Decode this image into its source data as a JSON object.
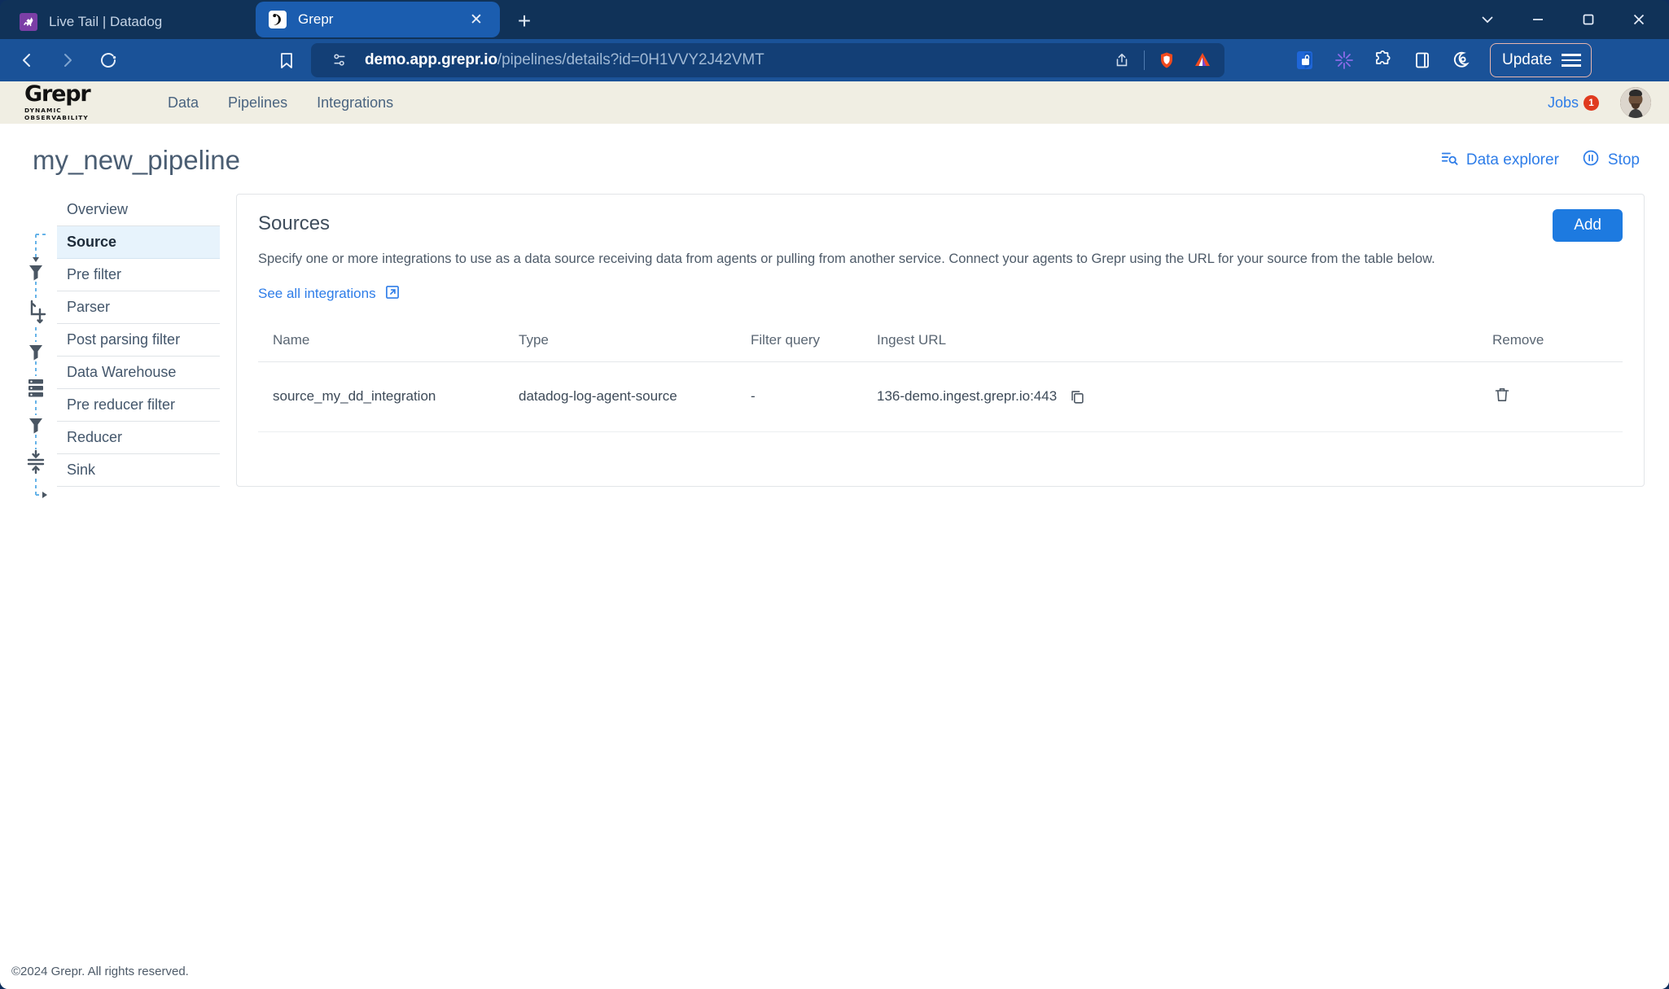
{
  "browser": {
    "tabs": [
      {
        "title": "Live Tail | Datadog",
        "favicon": "datadog-favicon",
        "active": false
      },
      {
        "title": "Grepr",
        "favicon": "grepr-favicon",
        "active": true
      }
    ],
    "close_label": "✕",
    "newtab_label": "+",
    "window_controls": {
      "expand": "⌄",
      "minimize": "─",
      "maximize": "□",
      "close": "✕"
    },
    "nav": {
      "back": "back-icon",
      "forward": "forward-icon",
      "reload": "reload-icon",
      "bookmark": "bookmark-icon"
    },
    "url": {
      "host": "demo.app.grepr.io",
      "path": "/pipelines/details?id=0H1VVY2J42VMT"
    },
    "url_actions": [
      "share-icon",
      "brave-shields-icon",
      "brave-rewards-icon"
    ],
    "extensions": [
      "bitwarden-icon",
      "extension-sparkle-icon",
      "puzzle-extensions-icon",
      "sidebar-panel-icon",
      "brave-leo-icon"
    ],
    "update_label": "Update"
  },
  "app": {
    "logo": {
      "word": "Grepr",
      "tagline": "DYNAMIC OBSERVABILITY"
    },
    "nav_links": [
      {
        "label": "Data"
      },
      {
        "label": "Pipelines"
      },
      {
        "label": "Integrations"
      }
    ],
    "jobs": {
      "label": "Jobs",
      "badge": "1"
    },
    "avatar_name": "user-avatar"
  },
  "page": {
    "title": "my_new_pipeline",
    "actions": [
      {
        "label": "Data explorer",
        "icon": "data-explorer-icon"
      },
      {
        "label": "Stop",
        "icon": "pause-circle-icon"
      }
    ]
  },
  "sidebar": {
    "items": [
      {
        "label": "Overview",
        "active": false,
        "icon": ""
      },
      {
        "label": "Source",
        "active": true,
        "icon": "source-node-icon"
      },
      {
        "label": "Pre filter",
        "active": false,
        "icon": "funnel-icon"
      },
      {
        "label": "Parser",
        "active": false,
        "icon": "parser-icon"
      },
      {
        "label": "Post parsing filter",
        "active": false,
        "icon": "funnel-icon"
      },
      {
        "label": "Data Warehouse",
        "active": false,
        "icon": "database-icon"
      },
      {
        "label": "Pre reducer filter",
        "active": false,
        "icon": "funnel-icon"
      },
      {
        "label": "Reducer",
        "active": false,
        "icon": "reducer-icon"
      },
      {
        "label": "Sink",
        "active": false,
        "icon": "arrow-sink-icon"
      }
    ]
  },
  "panel": {
    "title": "Sources",
    "description": "Specify one or more integrations to use as a data source receiving data from agents or pulling from another service. Connect your agents to Grepr using the URL for your source from the table below.",
    "link_label": "See all integrations",
    "link_icon": "external-link-icon",
    "add_label": "Add",
    "table": {
      "columns": [
        "Name",
        "Type",
        "Filter query",
        "Ingest URL",
        "Remove"
      ],
      "rows": [
        {
          "name": "source_my_dd_integration",
          "type": "datadog-log-agent-source",
          "filter_query": "-",
          "ingest_url": "136-demo.ingest.grepr.io:443",
          "copy_icon": "copy-icon",
          "remove_icon": "trash-icon"
        }
      ]
    }
  },
  "footer": {
    "text": "©2024 Grepr. All rights reserved."
  },
  "colors": {
    "accent_blue": "#2e7de8",
    "add_button": "#1d7ae0",
    "badge_red": "#e03a1e",
    "header_cream": "#f0eee3",
    "active_row": "#e7f3fc",
    "browser_chrome": "#1a5298"
  }
}
